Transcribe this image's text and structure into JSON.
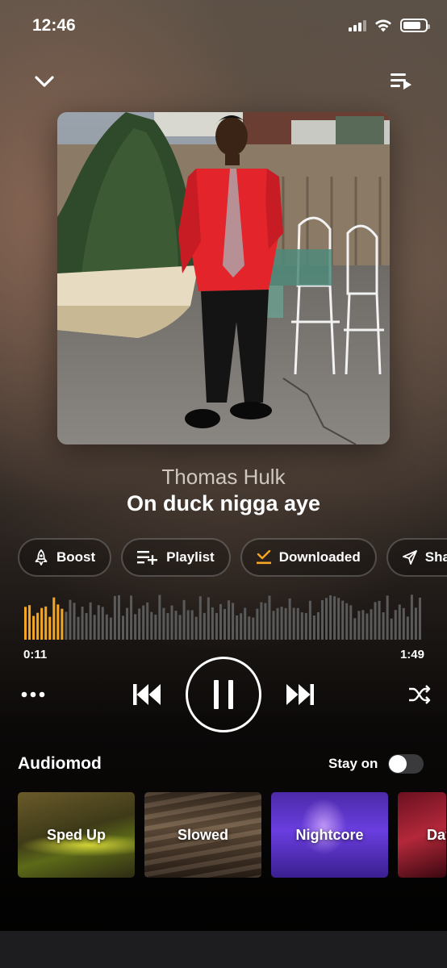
{
  "status_bar": {
    "time": "12:46"
  },
  "header": {
    "collapse_icon": "chevron-down-icon",
    "queue_icon": "queue-list-icon"
  },
  "track": {
    "artist": "Thomas Hulk",
    "title": "On duck nigga aye"
  },
  "actions": [
    {
      "label": "Boost",
      "icon": "rocket-icon"
    },
    {
      "label": "Playlist",
      "icon": "playlist-add-icon"
    },
    {
      "label": "Downloaded",
      "icon": "download-check-icon",
      "accent": "#f5a623"
    },
    {
      "label": "Share",
      "icon": "send-icon"
    }
  ],
  "player": {
    "current_time": "0:11",
    "total_time": "1:49",
    "progress": 0.1,
    "state": "playing",
    "played_color": "#f5a623"
  },
  "audiomod": {
    "title": "Audiomod",
    "stay_on_label": "Stay on",
    "stay_on": false,
    "presets": [
      {
        "label": "Sped Up"
      },
      {
        "label": "Slowed"
      },
      {
        "label": "Nightcore"
      },
      {
        "label": "Day"
      }
    ]
  }
}
